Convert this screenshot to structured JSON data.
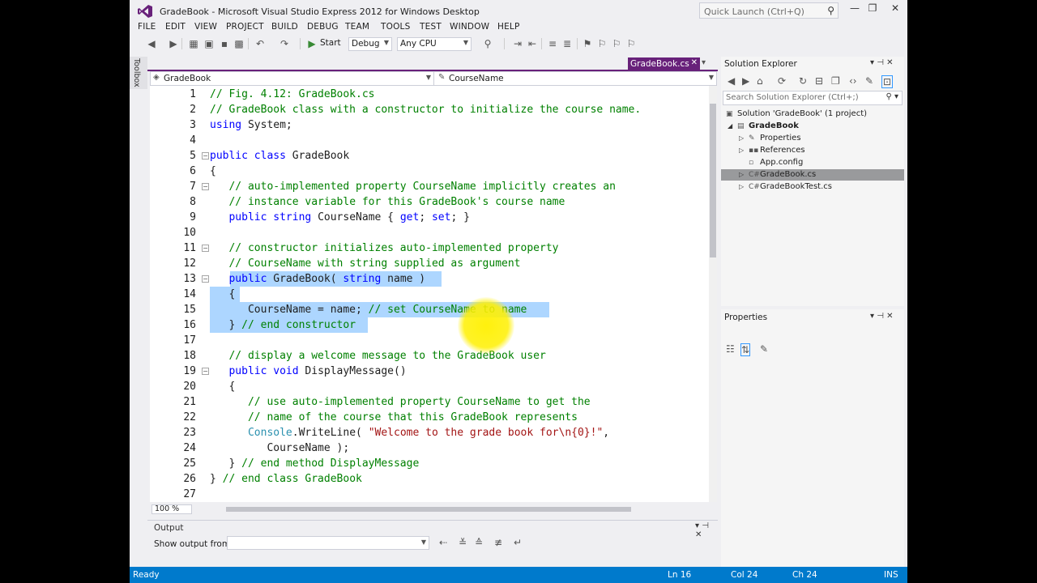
{
  "window": {
    "title": "GradeBook - Microsoft Visual Studio Express 2012 for Windows Desktop",
    "quick_launch_placeholder": "Quick Launch (Ctrl+Q)"
  },
  "menu": [
    "FILE",
    "EDIT",
    "VIEW",
    "PROJECT",
    "BUILD",
    "DEBUG",
    "TEAM",
    "TOOLS",
    "TEST",
    "WINDOW",
    "HELP"
  ],
  "toolbar": {
    "start_label": "Start",
    "config": "Debug",
    "platform": "Any CPU"
  },
  "toolbox_label": "Toolbox",
  "editor": {
    "tab_label": "GradeBook.cs",
    "nav_left": "GradeBook",
    "nav_right": "CourseName",
    "zoom": "100 %",
    "line_numbers": [
      "1",
      "2",
      "3",
      "4",
      "5",
      "6",
      "7",
      "8",
      "9",
      "10",
      "11",
      "12",
      "13",
      "14",
      "15",
      "16",
      "17",
      "18",
      "19",
      "20",
      "21",
      "22",
      "23",
      "24",
      "25",
      "26",
      "27"
    ],
    "selected_lines": [
      "13",
      "14",
      "15",
      "16"
    ],
    "lines": [
      "// Fig. 4.12: GradeBook.cs",
      "// GradeBook class with a constructor to initialize the course name.",
      "using System;",
      "",
      "public class GradeBook",
      "{",
      "   // auto-implemented property CourseName implicitly creates an",
      "   // instance variable for this GradeBook's course name",
      "   public string CourseName { get; set; }",
      "",
      "   // constructor initializes auto-implemented property",
      "   // CourseName with string supplied as argument",
      "   public GradeBook( string name )",
      "   {",
      "      CourseName = name; // set CourseName to name",
      "   } // end constructor",
      "",
      "   // display a welcome message to the GradeBook user",
      "   public void DisplayMessage()",
      "   {",
      "      // use auto-implemented property CourseName to get the",
      "      // name of the course that this GradeBook represents",
      "      Console.WriteLine( \"Welcome to the grade book for\\n{0}!\",",
      "         CourseName );",
      "   } // end method DisplayMessage",
      "} // end class GradeBook",
      ""
    ]
  },
  "output": {
    "title": "Output",
    "show_from_label": "Show output from:",
    "show_from_value": ""
  },
  "solution_explorer": {
    "title": "Solution Explorer",
    "search_placeholder": "Search Solution Explorer (Ctrl+;)",
    "solution": "Solution 'GradeBook' (1 project)",
    "project": "GradeBook",
    "items": [
      "Properties",
      "References",
      "App.config",
      "GradeBook.cs",
      "GradeBookTest.cs"
    ],
    "selected_item": "GradeBook.cs"
  },
  "properties": {
    "title": "Properties"
  },
  "status": {
    "state": "Ready",
    "ln": "Ln 16",
    "col": "Col 24",
    "ch": "Ch 24",
    "mode": "INS"
  },
  "colors": {
    "accent_purple": "#68217a",
    "status_blue": "#007acc",
    "selection": "#add6ff",
    "keyword": "#0000ff",
    "comment": "#008000",
    "type": "#2b91af",
    "string": "#a31515"
  }
}
